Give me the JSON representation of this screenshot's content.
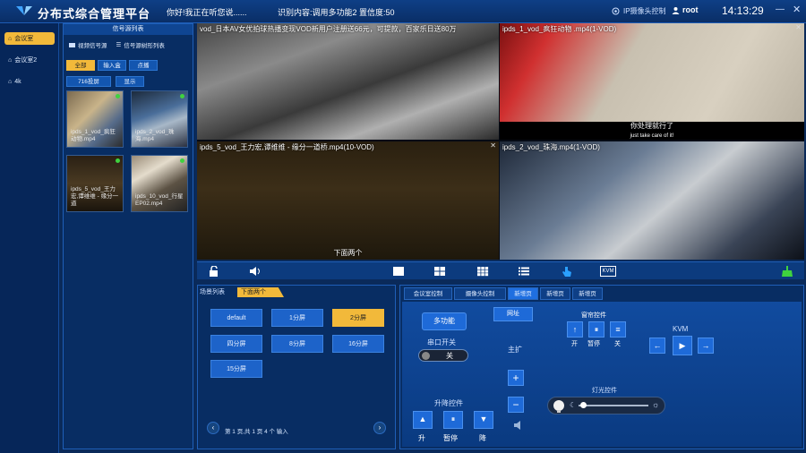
{
  "header": {
    "title": "分布式综合管理平台",
    "voice_hello": "你好!我正在听您说......",
    "voice_result": "识别内容:调用多功能2 置信度:50",
    "ip_camera_control": "IP摄像头控制",
    "user": "root",
    "clock": "14:13:29"
  },
  "sidebar": {
    "rooms": [
      {
        "label": "会议室",
        "active": true
      },
      {
        "label": "会议室2",
        "active": false
      },
      {
        "label": "4k",
        "active": false
      }
    ]
  },
  "signal_panel": {
    "title": "信号源列表",
    "tabs": [
      "视频信号源",
      "信号源树形列表"
    ],
    "filters": [
      "全部",
      "输入盒",
      "点播",
      "716投屏",
      "显示"
    ],
    "thumbs": [
      {
        "caption": "ipds_1_vod_疯狂动物.mp4"
      },
      {
        "caption": "ipds_2_vod_珠海.mp4"
      },
      {
        "caption": "ipds_5_vod_王力宏,谭维维 - 缘分一道"
      },
      {
        "caption": "ipds_10_vod_行星EP02.mp4"
      }
    ]
  },
  "videos": [
    {
      "label": "vod_日本AV女优拍球热播变现VOD新用户注册送66元，可提款，百家乐日送80万",
      "sub": ""
    },
    {
      "label": "ipds_1_vod_疯狂动物 .mp4(1-VOD)",
      "sub": "你处理就行了",
      "sub2": "just take care of it!"
    },
    {
      "label": "ipds_5_vod_王力宏,谭维维 - 缘分一道桥.mp4(10-VOD)",
      "sub": "下面两个"
    },
    {
      "label": "ipds_2_vod_珠海.mp4(1-VOD)",
      "sub": ""
    }
  ],
  "toolbar": {
    "kvm": "KVM"
  },
  "scene_panel": {
    "tab": "场景列表",
    "current": "下面两个",
    "buttons": [
      "default",
      "1分屏",
      "2分屏",
      "四分屏",
      "8分屏",
      "16分屏",
      "15分屏"
    ],
    "active_index": 2,
    "pager": "第 1 页,共 1 页 4 个 输入"
  },
  "control_panel": {
    "tabs": [
      "会议室控制",
      "摄像头控制",
      "新增页",
      "新增页",
      "新增页"
    ],
    "active_tab": 2,
    "multi_function": "多功能",
    "website": "网址",
    "serial_switch": "串口开关",
    "serial_state": "关",
    "main_expand": "主扩",
    "lift_control": "升降控件",
    "lift_buttons": [
      "升",
      "暂停",
      "降"
    ],
    "curtain_control": "窗帘控件",
    "curtain_buttons": [
      "开",
      "暂停",
      "关"
    ],
    "kvm_label": "KVM",
    "light_control": "灯光控件"
  }
}
